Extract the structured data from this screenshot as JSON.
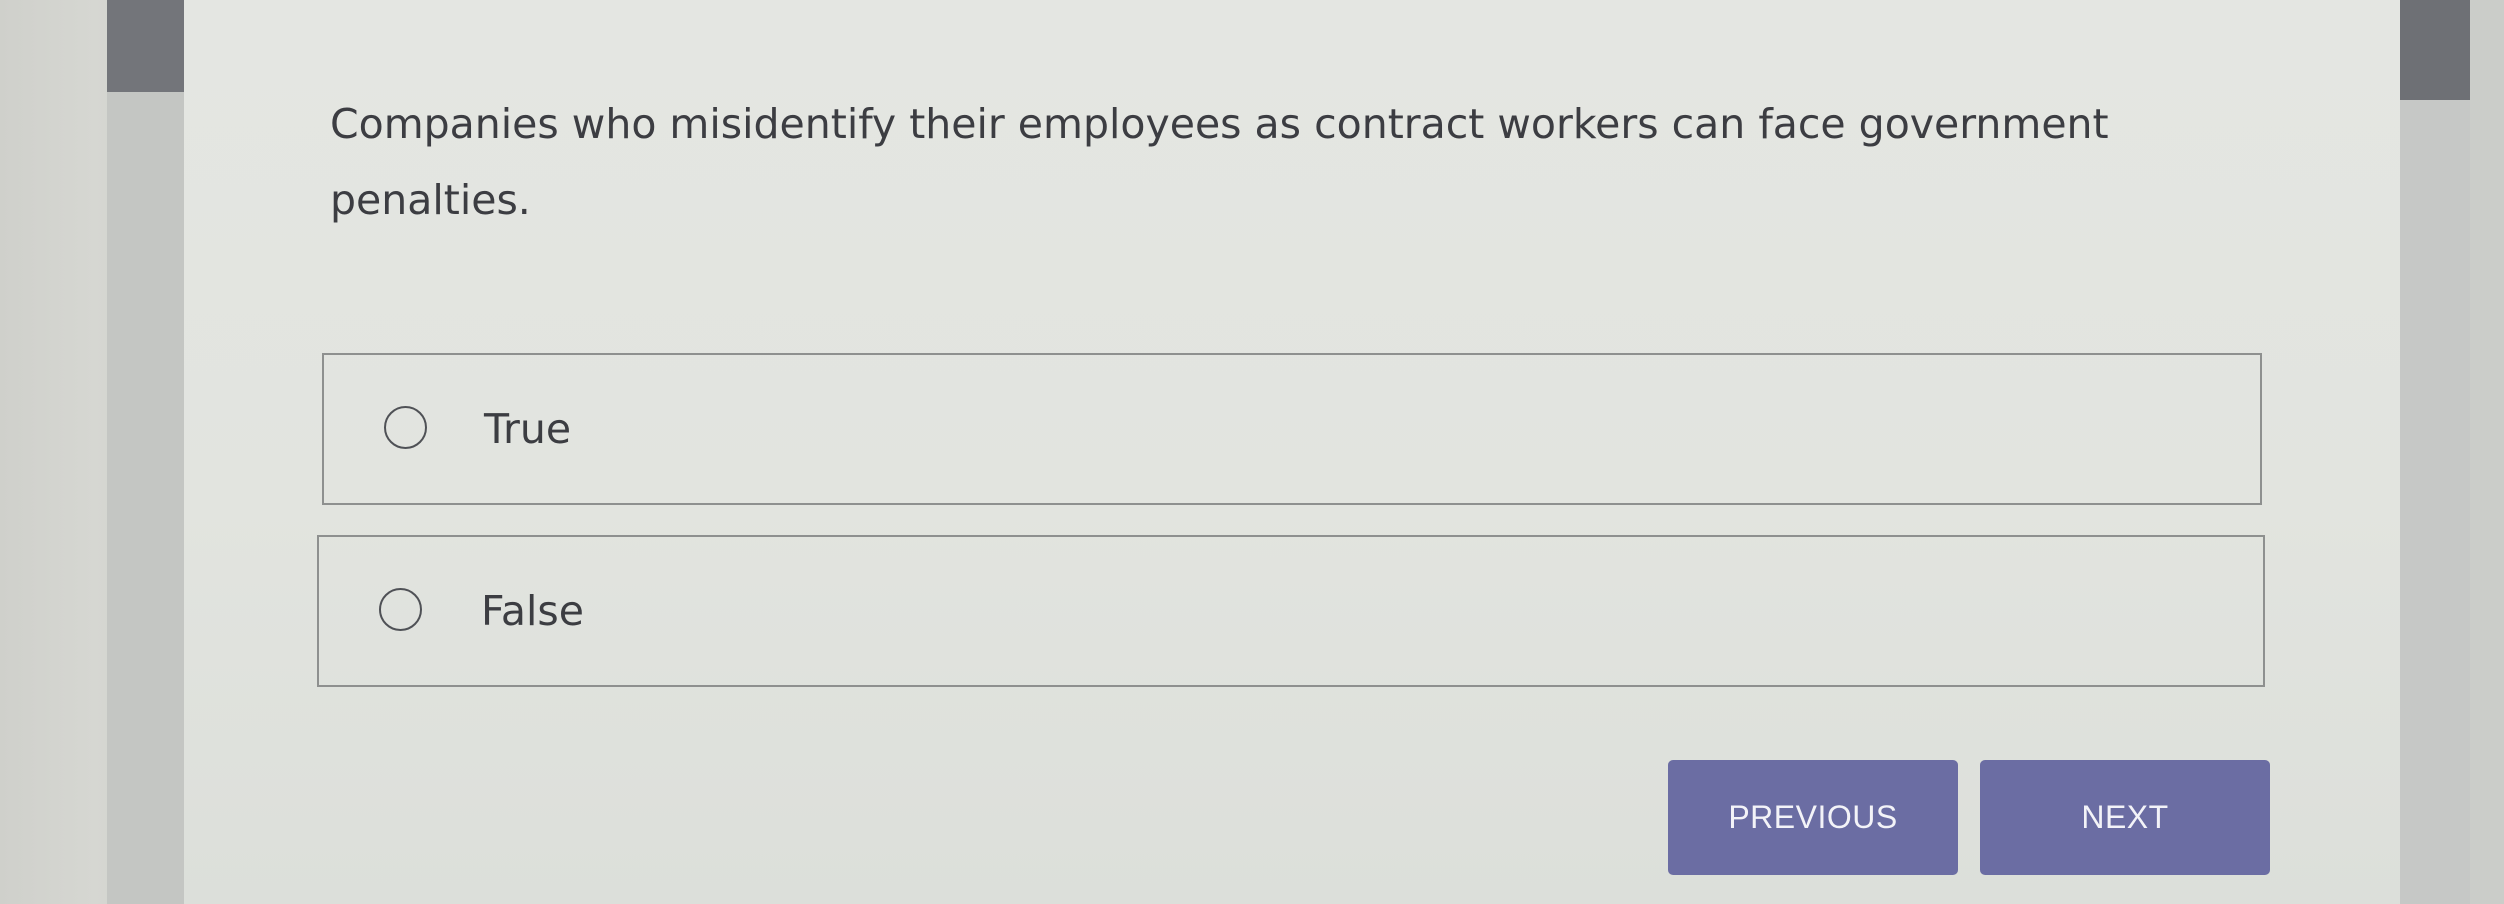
{
  "question": {
    "text": "Companies who misidentify their employees as contract workers can face government penalties."
  },
  "options": [
    {
      "label": "True",
      "selected": false
    },
    {
      "label": "False",
      "selected": false
    }
  ],
  "navigation": {
    "previous_label": "PREVIOUS",
    "next_label": "NEXT"
  },
  "colors": {
    "button": "#6b6da3",
    "button_text": "#f3f3f8",
    "text": "#3c3d42",
    "panel": "#e3e5e1",
    "option_border": "#8e908f",
    "side_rail_dark": "#73757a"
  }
}
